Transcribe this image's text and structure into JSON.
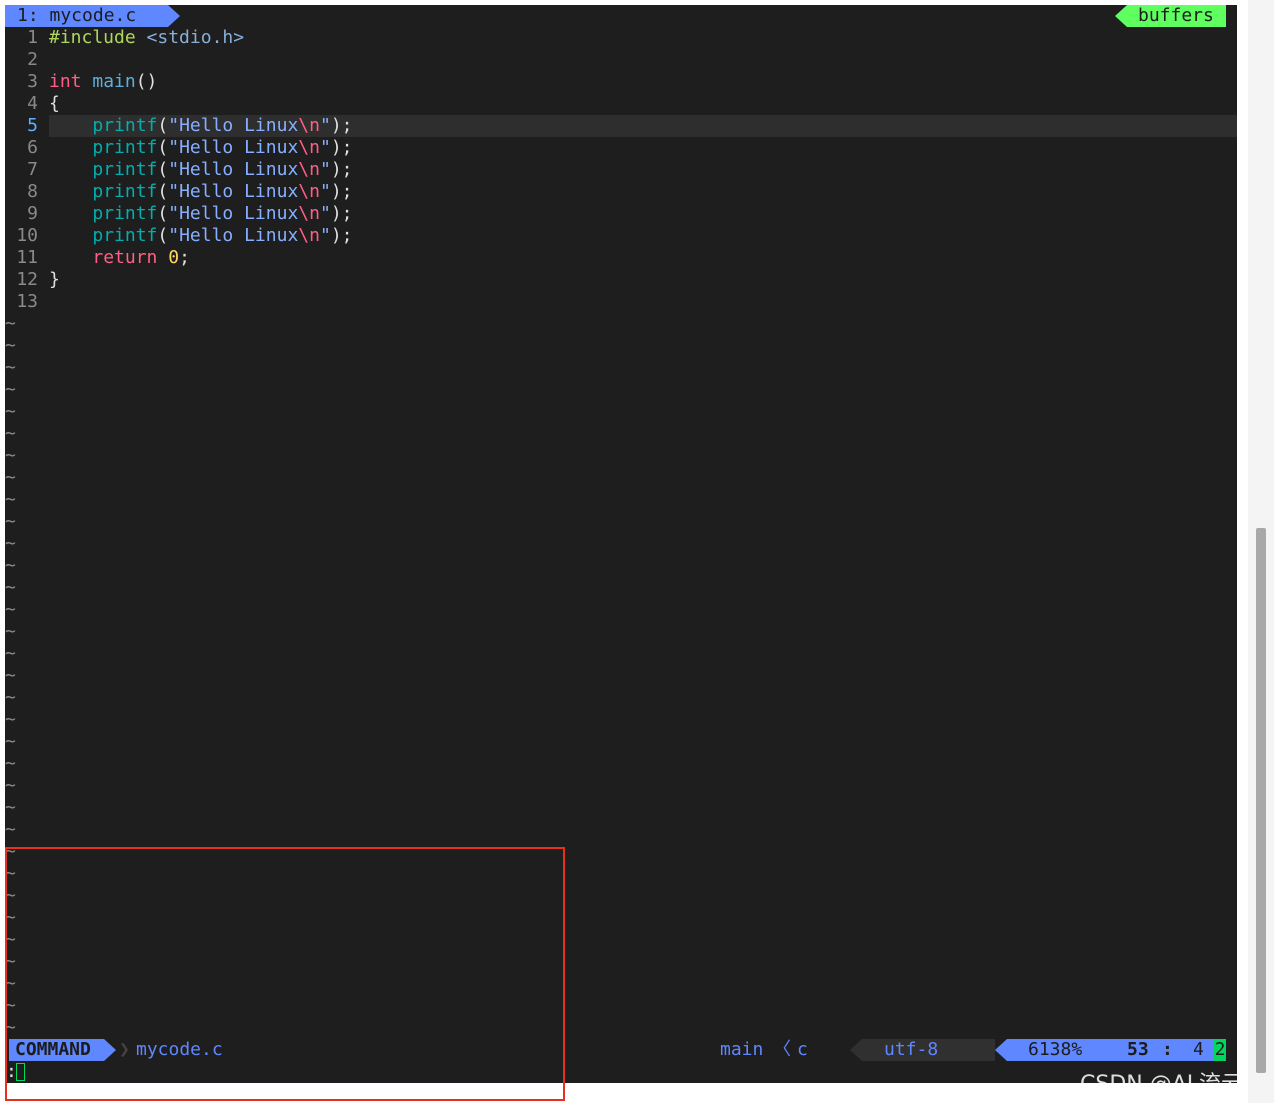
{
  "tabline": {
    "active_tab": "1: mycode.c",
    "right_label": "buffers"
  },
  "editor": {
    "cursor_line_number": 5,
    "lines": [
      {
        "n": "1",
        "tokens": [
          {
            "t": "#include",
            "c": "pre"
          },
          {
            "t": " ",
            "c": "punct"
          },
          {
            "t": "<stdio.h>",
            "c": "inc"
          }
        ]
      },
      {
        "n": "2",
        "tokens": []
      },
      {
        "n": "3",
        "tokens": [
          {
            "t": "int",
            "c": "type"
          },
          {
            "t": " ",
            "c": "punct"
          },
          {
            "t": "main",
            "c": "fn"
          },
          {
            "t": "()",
            "c": "punct"
          }
        ]
      },
      {
        "n": "4",
        "tokens": [
          {
            "t": "{",
            "c": "punct"
          }
        ]
      },
      {
        "n": "5",
        "tokens": [
          {
            "t": "    ",
            "c": "punct"
          },
          {
            "t": "printf",
            "c": "call"
          },
          {
            "t": "(",
            "c": "punct"
          },
          {
            "t": "\"Hello Linux",
            "c": "str"
          },
          {
            "t": "\\n",
            "c": "esc"
          },
          {
            "t": "\"",
            "c": "str"
          },
          {
            "t": ");",
            "c": "punct"
          }
        ]
      },
      {
        "n": "6",
        "tokens": [
          {
            "t": "    ",
            "c": "punct"
          },
          {
            "t": "printf",
            "c": "call"
          },
          {
            "t": "(",
            "c": "punct"
          },
          {
            "t": "\"Hello Linux",
            "c": "str"
          },
          {
            "t": "\\n",
            "c": "esc"
          },
          {
            "t": "\"",
            "c": "str"
          },
          {
            "t": ");",
            "c": "punct"
          }
        ]
      },
      {
        "n": "7",
        "tokens": [
          {
            "t": "    ",
            "c": "punct"
          },
          {
            "t": "printf",
            "c": "call"
          },
          {
            "t": "(",
            "c": "punct"
          },
          {
            "t": "\"Hello Linux",
            "c": "str"
          },
          {
            "t": "\\n",
            "c": "esc"
          },
          {
            "t": "\"",
            "c": "str"
          },
          {
            "t": ");",
            "c": "punct"
          }
        ]
      },
      {
        "n": "8",
        "tokens": [
          {
            "t": "    ",
            "c": "punct"
          },
          {
            "t": "printf",
            "c": "call"
          },
          {
            "t": "(",
            "c": "punct"
          },
          {
            "t": "\"Hello Linux",
            "c": "str"
          },
          {
            "t": "\\n",
            "c": "esc"
          },
          {
            "t": "\"",
            "c": "str"
          },
          {
            "t": ");",
            "c": "punct"
          }
        ]
      },
      {
        "n": "9",
        "tokens": [
          {
            "t": "    ",
            "c": "punct"
          },
          {
            "t": "printf",
            "c": "call"
          },
          {
            "t": "(",
            "c": "punct"
          },
          {
            "t": "\"Hello Linux",
            "c": "str"
          },
          {
            "t": "\\n",
            "c": "esc"
          },
          {
            "t": "\"",
            "c": "str"
          },
          {
            "t": ");",
            "c": "punct"
          }
        ]
      },
      {
        "n": "10",
        "tokens": [
          {
            "t": "    ",
            "c": "punct"
          },
          {
            "t": "printf",
            "c": "call"
          },
          {
            "t": "(",
            "c": "punct"
          },
          {
            "t": "\"Hello Linux",
            "c": "str"
          },
          {
            "t": "\\n",
            "c": "esc"
          },
          {
            "t": "\"",
            "c": "str"
          },
          {
            "t": ");",
            "c": "punct"
          }
        ]
      },
      {
        "n": "11",
        "tokens": [
          {
            "t": "    ",
            "c": "punct"
          },
          {
            "t": "return",
            "c": "kw"
          },
          {
            "t": " ",
            "c": "punct"
          },
          {
            "t": "0",
            "c": "num"
          },
          {
            "t": ";",
            "c": "punct"
          }
        ]
      },
      {
        "n": "12",
        "tokens": [
          {
            "t": "}",
            "c": "punct"
          }
        ]
      },
      {
        "n": "13",
        "tokens": []
      }
    ],
    "empty_line_marker": "~",
    "empty_line_count": 33
  },
  "statusline": {
    "mode": "COMMAND",
    "separator": "❯",
    "filename": "mycode.c",
    "function": "main",
    "func_separator": "〈",
    "filetype": "c",
    "encoding": "utf-8",
    "percent": "6138%",
    "line": "53",
    "colon": ":",
    "column": "4",
    "warning_count": "2"
  },
  "cmdline": {
    "prompt": ":"
  },
  "watermark": "CSDN @AL流云。",
  "colors": {
    "background": "#1e1e1e",
    "accent_blue": "#5f87ff",
    "accent_green": "#5fff5f",
    "highlight_box": "#e8301a"
  }
}
